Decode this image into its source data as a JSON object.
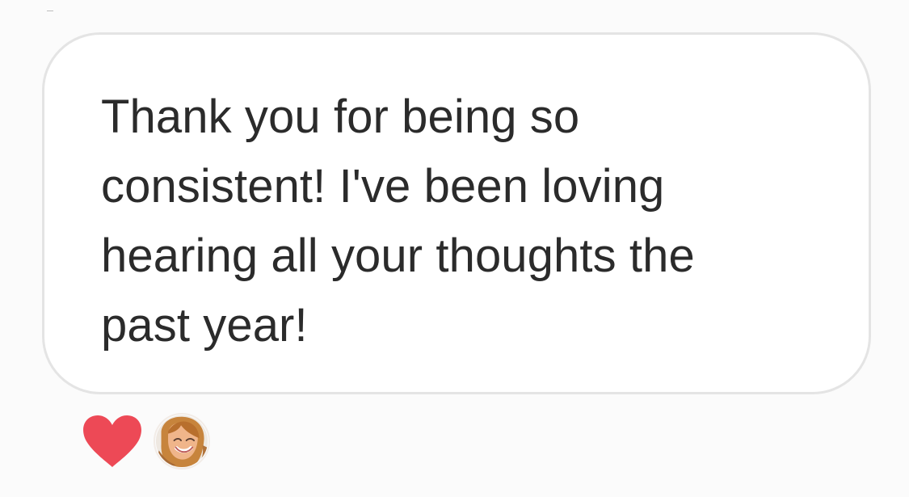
{
  "message": {
    "text": "Thank you for being so\nconsistent! I've been loving\nhearing all your thoughts the\npast year!"
  },
  "reactions": [
    {
      "type": "heart",
      "icon": "heart-icon",
      "color": "#ed4956"
    }
  ],
  "sender": {
    "avatar": "profile-avatar"
  },
  "colors": {
    "background": "#fbfbfb",
    "bubble": "#ffffff",
    "bubble_border": "#e4e4e4",
    "text": "#2b2b2b"
  }
}
